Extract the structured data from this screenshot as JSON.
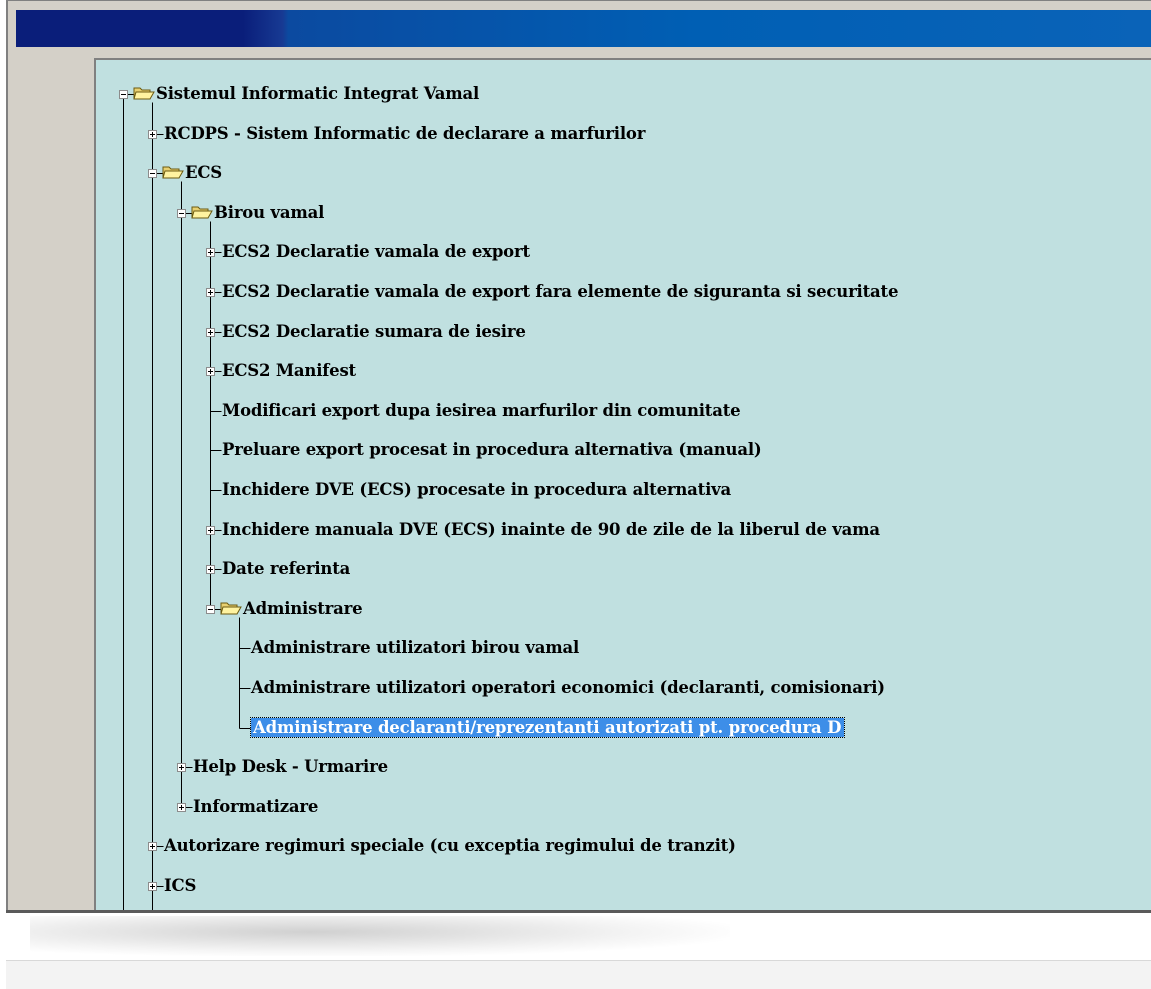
{
  "tree": {
    "nodes": [
      {
        "label": "Sistemul Informatic Integrat Vamal",
        "expander": "minus",
        "folder": true
      },
      {
        "label": "RCDPS - Sistem Informatic de declarare a marfurilor",
        "expander": "plus",
        "folder": false
      },
      {
        "label": "ECS",
        "expander": "minus",
        "folder": true
      },
      {
        "label": "Birou vamal",
        "expander": "minus",
        "folder": true
      },
      {
        "label": "ECS2 Declaratie vamala de export",
        "expander": "plus",
        "folder": false
      },
      {
        "label": "ECS2 Declaratie vamala de export fara elemente de siguranta si securitate",
        "expander": "plus",
        "folder": false
      },
      {
        "label": "ECS2 Declaratie sumara de iesire",
        "expander": "plus",
        "folder": false
      },
      {
        "label": "ECS2 Manifest",
        "expander": "plus",
        "folder": false
      },
      {
        "label": "Modificari export dupa iesirea marfurilor din comunitate",
        "expander": "none",
        "folder": false
      },
      {
        "label": "Preluare export procesat in procedura alternativa (manual)",
        "expander": "none",
        "folder": false
      },
      {
        "label": "Inchidere DVE (ECS) procesate in procedura alternativa",
        "expander": "none",
        "folder": false
      },
      {
        "label": "Inchidere manuala DVE (ECS) inainte de 90 de zile de la liberul de vama",
        "expander": "plus",
        "folder": false
      },
      {
        "label": "Date referinta",
        "expander": "plus",
        "folder": false
      },
      {
        "label": "Administrare",
        "expander": "minus",
        "folder": true
      },
      {
        "label": "Administrare utilizatori birou vamal",
        "expander": "none",
        "folder": false
      },
      {
        "label": "Administrare utilizatori operatori economici (declaranti, comisionari)",
        "expander": "none",
        "folder": false
      },
      {
        "label": "Administrare declaranti/reprezentanti autorizati pt. procedura D",
        "expander": "none",
        "folder": false,
        "selected": true
      },
      {
        "label": "Help Desk - Urmarire",
        "expander": "plus",
        "folder": false
      },
      {
        "label": "Informatizare",
        "expander": "plus",
        "folder": false
      },
      {
        "label": "Autorizare regimuri speciale (cu exceptia regimului de tranzit)",
        "expander": "plus",
        "folder": false
      },
      {
        "label": "ICS",
        "expander": "plus",
        "folder": false
      }
    ]
  },
  "colors": {
    "tree_background": "#c0e0e0",
    "selection": "#3d8ee8",
    "titlebar_dark": "#0a1e7a",
    "titlebar_light": "#0a63b8"
  }
}
